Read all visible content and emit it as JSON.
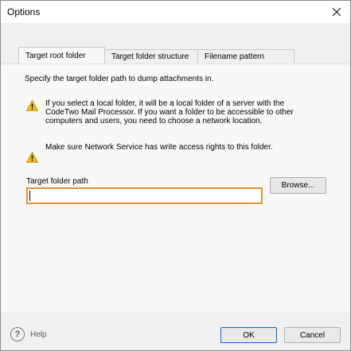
{
  "window": {
    "title": "Options",
    "close_icon": "close-icon"
  },
  "tabs": [
    {
      "label": "Target root folder",
      "active": true
    },
    {
      "label": "Target folder structure",
      "active": false
    },
    {
      "label": "Filename pattern",
      "active": false
    }
  ],
  "panel": {
    "description": "Specify the target folder path to dump attachments in.",
    "warnings": [
      {
        "icon": "warning-icon",
        "text": "If you select a local folder, it will be a local folder of a server with the CodeTwo Mail Processor. If you want a folder to be accessible to other computers and users, you need to choose a network location."
      },
      {
        "icon": "warning-icon",
        "text": "Make sure Network Service has write access rights to this folder."
      }
    ],
    "field_label": "Target folder path",
    "path_value": "",
    "browse_label": "Browse..."
  },
  "footer": {
    "help_label": "Help",
    "ok_label": "OK",
    "cancel_label": "Cancel"
  },
  "colors": {
    "input_focus_border": "#e7912e",
    "ok_border": "#0a64d0",
    "warning_yellow": "#f2c200"
  }
}
